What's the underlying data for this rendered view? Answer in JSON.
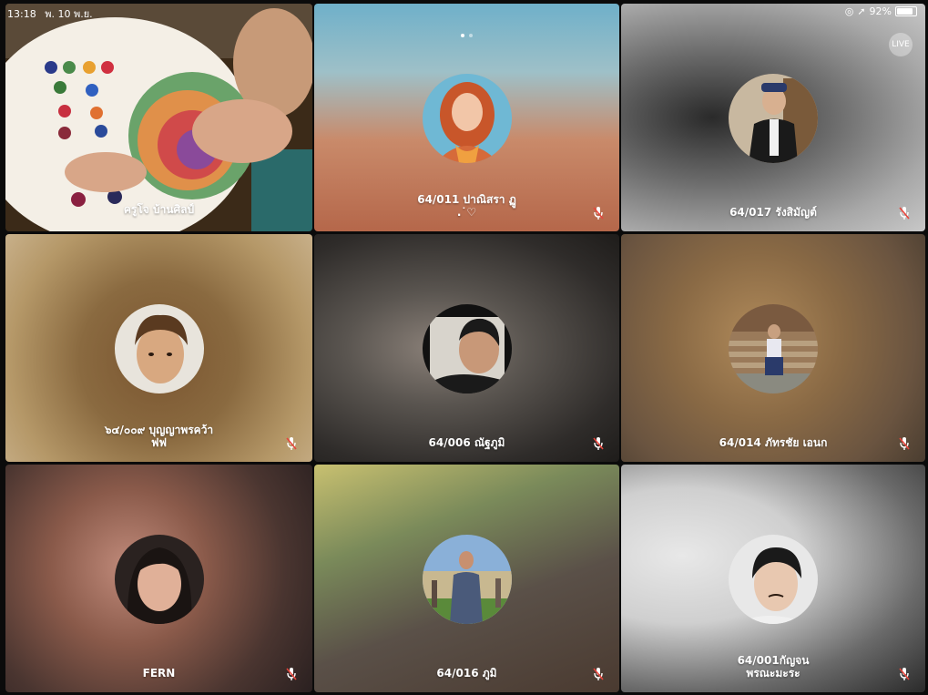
{
  "status_bar": {
    "time": "13:18",
    "date": "พ. 10 พ.ย.",
    "battery": "92%",
    "battery_level": 0.92
  },
  "page_indicator": {
    "pages": 2,
    "current": 1
  },
  "share_button_label": "LIVE",
  "participants": [
    {
      "name": "ครูโจ บ้านศิลป์",
      "muted": false,
      "video_on": true
    },
    {
      "name": "64/011 ปาณิสรา ฏู\n.˙♡",
      "muted": true,
      "video_on": false
    },
    {
      "name": "64/017 รังสิมัญต์",
      "muted": true,
      "video_on": false
    },
    {
      "name": "๖๔/๐๐๙ บุญญาพรคว้า\nฟฟ",
      "muted": true,
      "video_on": false
    },
    {
      "name": "64/006 ณัฐภูมิ",
      "muted": true,
      "video_on": false
    },
    {
      "name": "64/014 ภัทรชัย เอนก",
      "muted": true,
      "video_on": false
    },
    {
      "name": "FERN",
      "muted": true,
      "video_on": false
    },
    {
      "name": "64/016 ภูมิ",
      "muted": true,
      "video_on": false
    },
    {
      "name": "64/001กัญจน\nพรณะมะระ",
      "muted": true,
      "video_on": false
    }
  ],
  "colors": {
    "muted_icon": "#ffffff"
  }
}
